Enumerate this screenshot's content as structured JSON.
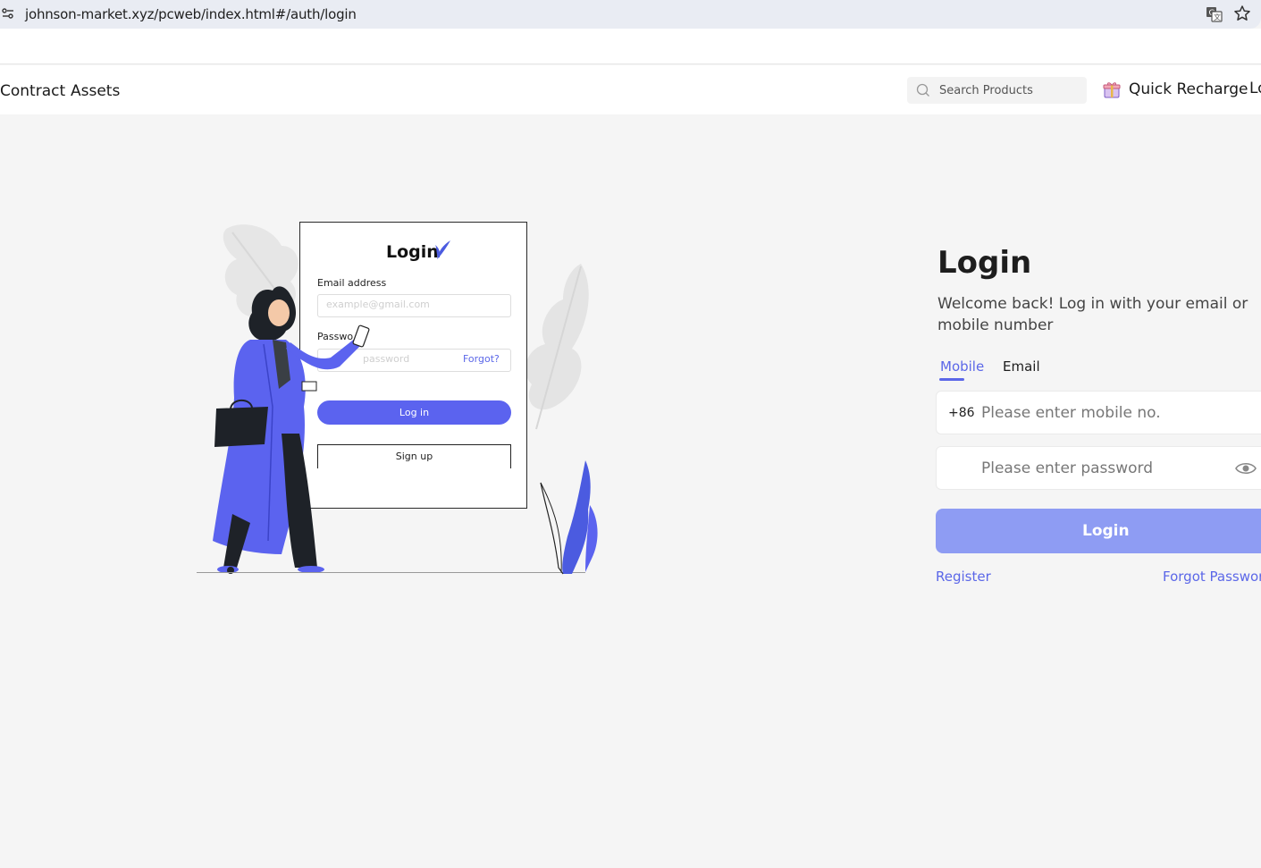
{
  "browser": {
    "url": "johnson-market.xyz/pcweb/index.html#/auth/login"
  },
  "nav": {
    "items": [
      {
        "label": "Contract"
      },
      {
        "label": "Assets"
      }
    ],
    "search_placeholder": "Search Products",
    "recharge_label": "Quick Recharge",
    "lang_label": "Lo"
  },
  "illustration": {
    "title": "Login",
    "email_label": "Email address",
    "email_placeholder": "example@gmail.com",
    "password_label": "Passwo",
    "password_placeholder": "password",
    "forgot": "Forgot?",
    "login_btn": "Log in",
    "signup_btn": "Sign up"
  },
  "login": {
    "title": "Login",
    "welcome": "Welcome back! Log in with your email or mobile number",
    "tabs": [
      {
        "label": "Mobile",
        "active": true
      },
      {
        "label": "Email",
        "active": false
      }
    ],
    "country_code": "+86",
    "mobile_placeholder": "Please enter mobile no.",
    "password_placeholder": "Please enter password",
    "submit_label": "Login",
    "register_label": "Register",
    "forgot_label": "Forgot Password"
  },
  "colors": {
    "accent": "#5b67e8",
    "button_disabled": "#8e9cf3",
    "page_bg": "#f5f5f5"
  }
}
